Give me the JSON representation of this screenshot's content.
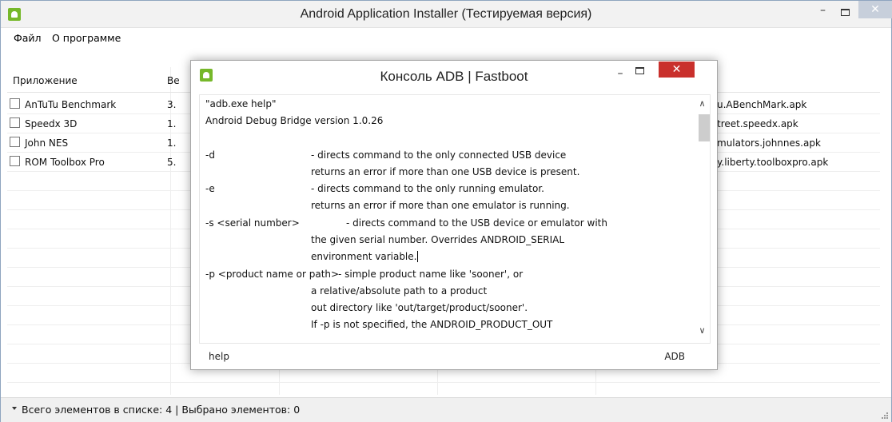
{
  "window": {
    "title": "Android Application Installer (Тестируемая версия)",
    "min_glyph": "–",
    "close_glyph": "✕",
    "icon": "android-icon"
  },
  "menu": {
    "items": [
      "Файл",
      "О программе"
    ]
  },
  "list": {
    "headers": [
      "Приложение",
      "Ве"
    ],
    "rows": [
      {
        "name": "AnTuTu Benchmark",
        "version": "3.",
        "file": "u.ABenchMark.apk"
      },
      {
        "name": "Speedx 3D",
        "version": "1.",
        "file": "treet.speedx.apk"
      },
      {
        "name": "John NES",
        "version": "1.",
        "file": "mulators.johnnes.apk"
      },
      {
        "name": "ROM Toolbox Pro",
        "version": "5.",
        "file": "y.liberty.toolboxpro.apk"
      }
    ]
  },
  "status": {
    "text": "Всего элементов в списке: 4 | Выбрано элементов: 0"
  },
  "console": {
    "title": "Консоль ADB | Fastboot",
    "min_glyph": "–",
    "close_glyph": "✕",
    "lines": [
      "\"adb.exe help\"",
      "Android Debug Bridge version 1.0.26",
      "",
      "-d",
      "- directs command to the only connected USB device",
      "returns an error if more than one USB device is present.",
      "-e",
      "- directs command to the only running emulator.",
      "returns an error if more than one emulator is running.",
      "-s <serial number>",
      "- directs command to the USB device or emulator with",
      "the given serial number. Overrides ANDROID_SERIAL",
      "environment variable.",
      "-p <product name or path>",
      "- simple product name like 'sooner', or",
      "a relative/absolute path to a product",
      "out directory like 'out/target/product/sooner'.",
      "If -p is not specified, the ANDROID_PRODUCT_OUT"
    ],
    "scroll_up": "∧",
    "scroll_down": "∨",
    "footer_left": "help",
    "footer_right": "ADB"
  }
}
